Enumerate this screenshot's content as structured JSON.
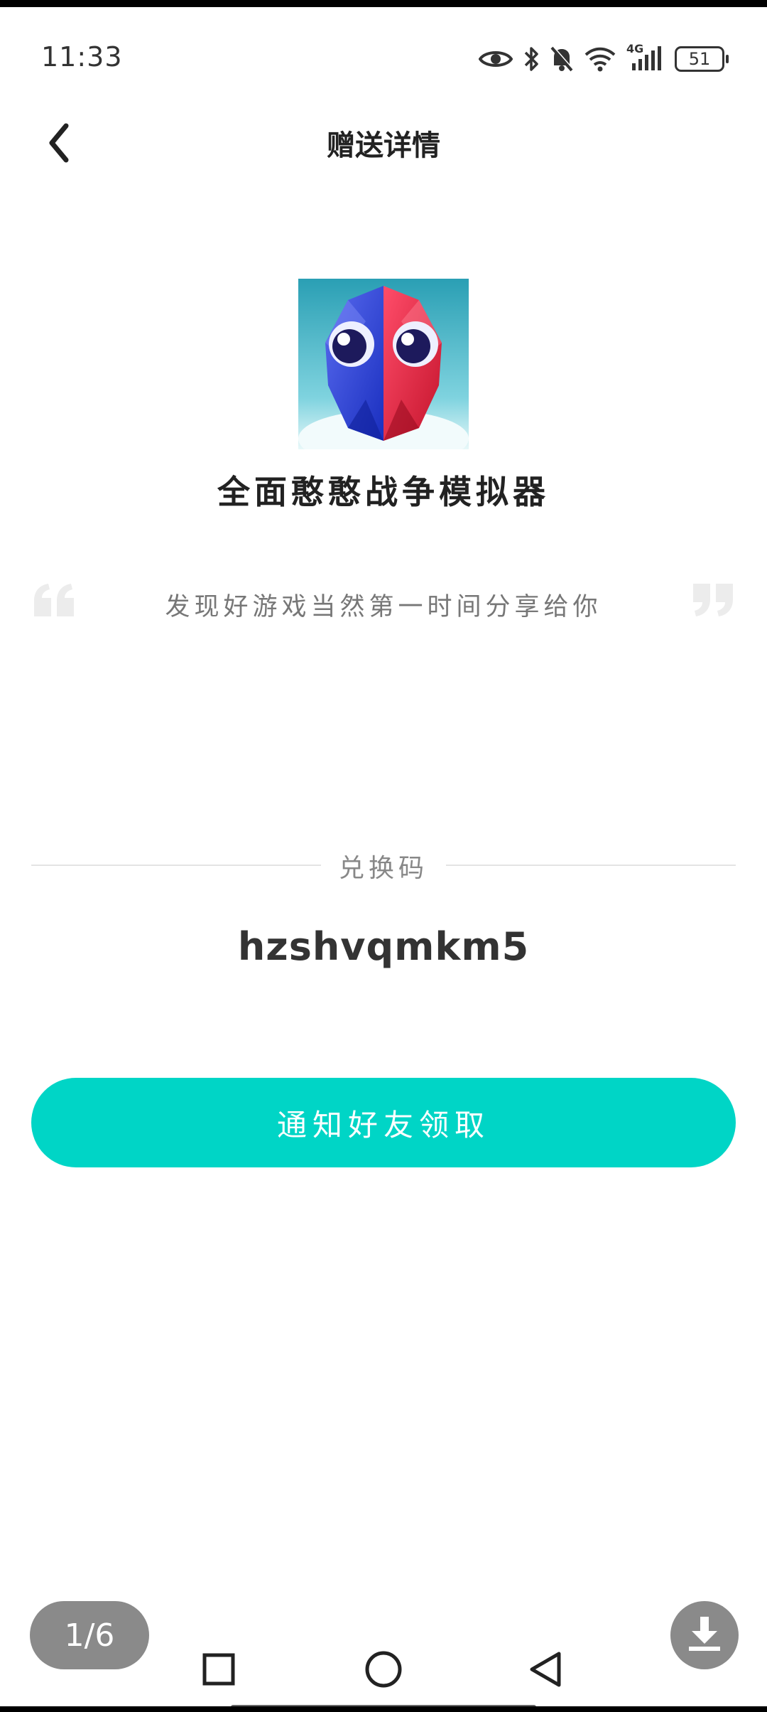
{
  "status_bar": {
    "time": "11:33",
    "battery": "51",
    "network": "4G",
    "icons": [
      "eye-icon",
      "bluetooth-icon",
      "mute-icon",
      "wifi-icon",
      "signal-icon",
      "battery-icon"
    ]
  },
  "header": {
    "title": "赠送详情",
    "back_icon": "chevron-left-icon"
  },
  "game": {
    "name": "全面憨憨战争模拟器",
    "icon": "game-icon"
  },
  "share_message": "发现好游戏当然第一时间分享给你",
  "redeem": {
    "label": "兑换码",
    "code": "hzshvqmkm5"
  },
  "notify_button_label": "通知好友领取",
  "overlay": {
    "page_indicator": "1/6",
    "download_icon": "download-icon"
  },
  "nav_bar": {
    "icons": [
      "recent-apps-icon",
      "home-icon",
      "back-icon"
    ]
  },
  "colors": {
    "accent": "#00d5c6",
    "text_primary": "#222222",
    "text_secondary": "#777777",
    "divider": "#e4e4e4"
  }
}
